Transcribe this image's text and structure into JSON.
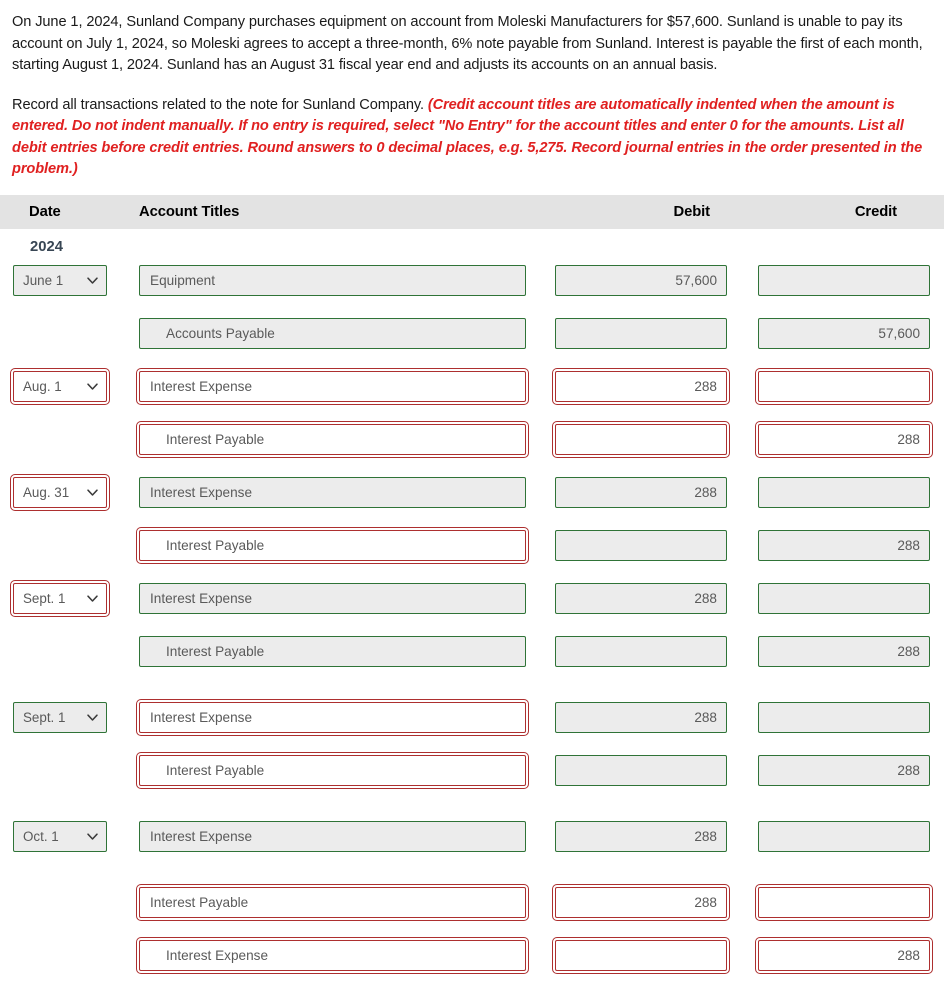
{
  "problem": {
    "paragraph1": "On June 1, 2024, Sunland Company purchases equipment on account from Moleski Manufacturers for $57,600. Sunland is unable to pay its account on July 1, 2024, so Moleski agrees to accept a three-month, 6% note payable from Sunland. Interest is payable the first of each month, starting August 1, 2024. Sunland has an August 31 fiscal year end and adjusts its accounts on an annual basis.",
    "instruction_lead": "Record all transactions related to the note for Sunland Company. ",
    "instruction_note": "(Credit account titles are automatically indented when the amount is entered. Do not indent manually. If no entry is required, select \"No Entry\" for the account titles and enter 0 for the amounts. List all debit entries before credit entries. Round answers to 0 decimal places, e.g. 5,275. Record journal entries in the order presented in the problem.)"
  },
  "table": {
    "headers": {
      "date": "Date",
      "account": "Account Titles",
      "debit": "Debit",
      "credit": "Credit"
    },
    "year": "2024",
    "rows": [
      {
        "date": "June 1",
        "date_state": "ok",
        "date_visible": true,
        "account": "Equipment",
        "account_state": "ok",
        "indent": false,
        "debit": "57,600",
        "debit_state": "ok",
        "credit": "",
        "credit_state": "ok",
        "gap_before": false
      },
      {
        "date": "",
        "date_state": "ok",
        "date_visible": false,
        "account": "Accounts Payable",
        "account_state": "ok",
        "indent": true,
        "debit": "",
        "debit_state": "ok",
        "credit": "57,600",
        "credit_state": "ok",
        "gap_before": false
      },
      {
        "date": "Aug. 1",
        "date_state": "bad",
        "date_visible": true,
        "account": "Interest Expense",
        "account_state": "bad",
        "indent": false,
        "debit": "288",
        "debit_state": "bad",
        "credit": "",
        "credit_state": "bad",
        "gap_before": false
      },
      {
        "date": "",
        "date_state": "ok",
        "date_visible": false,
        "account": "Interest Payable",
        "account_state": "bad",
        "indent": true,
        "debit": "",
        "debit_state": "bad",
        "credit": "288",
        "credit_state": "bad",
        "gap_before": false
      },
      {
        "date": "Aug. 31",
        "date_state": "bad",
        "date_visible": true,
        "account": "Interest Expense",
        "account_state": "ok",
        "indent": false,
        "debit": "288",
        "debit_state": "ok",
        "credit": "",
        "credit_state": "ok",
        "gap_before": false
      },
      {
        "date": "",
        "date_state": "ok",
        "date_visible": false,
        "account": "Interest Payable",
        "account_state": "bad",
        "indent": true,
        "debit": "",
        "debit_state": "ok",
        "credit": "288",
        "credit_state": "ok",
        "gap_before": false
      },
      {
        "date": "Sept. 1",
        "date_state": "bad",
        "date_visible": true,
        "account": "Interest Expense",
        "account_state": "ok",
        "indent": false,
        "debit": "288",
        "debit_state": "ok",
        "credit": "",
        "credit_state": "ok",
        "gap_before": false
      },
      {
        "date": "",
        "date_state": "ok",
        "date_visible": false,
        "account": "Interest Payable",
        "account_state": "ok",
        "indent": true,
        "debit": "",
        "debit_state": "ok",
        "credit": "288",
        "credit_state": "ok",
        "gap_before": false
      },
      {
        "date": "Sept. 1",
        "date_state": "ok",
        "date_visible": true,
        "account": "Interest Expense",
        "account_state": "bad",
        "indent": false,
        "debit": "288",
        "debit_state": "ok",
        "credit": "",
        "credit_state": "ok",
        "gap_before": true
      },
      {
        "date": "",
        "date_state": "ok",
        "date_visible": false,
        "account": "Interest Payable",
        "account_state": "bad",
        "indent": true,
        "debit": "",
        "debit_state": "ok",
        "credit": "288",
        "credit_state": "ok",
        "gap_before": false
      },
      {
        "date": "Oct. 1",
        "date_state": "ok",
        "date_visible": true,
        "account": "Interest Expense",
        "account_state": "ok",
        "indent": false,
        "debit": "288",
        "debit_state": "ok",
        "credit": "",
        "credit_state": "ok",
        "gap_before": true
      },
      {
        "date": "",
        "date_state": "ok",
        "date_visible": false,
        "account": "Interest Payable",
        "account_state": "bad",
        "indent": false,
        "debit": "288",
        "debit_state": "bad",
        "credit": "",
        "credit_state": "bad",
        "gap_before": true
      },
      {
        "date": "",
        "date_state": "ok",
        "date_visible": false,
        "account": "Interest Expense",
        "account_state": "bad",
        "indent": true,
        "debit": "",
        "debit_state": "bad",
        "credit": "288",
        "credit_state": "bad",
        "gap_before": false
      }
    ]
  },
  "colors": {
    "valid_border": "#2f7337",
    "invalid_border": "#ad2f2f",
    "field_fill": "#ececec",
    "header_fill": "#e3e3e3",
    "note_text": "#e02020",
    "field_text": "#5a5a5a"
  }
}
